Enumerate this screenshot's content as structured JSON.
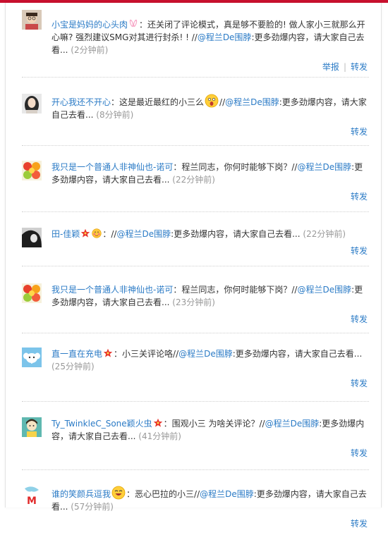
{
  "posts": [
    {
      "user": "小宝是妈妈的心头肉",
      "sep": "：",
      "text": "还关闭了评论模式，真是够不要脸的! 做人家小三就那么开心嘛? 强烈建议SMG对其进行封杀! ! ",
      "repost_prefix": "//",
      "mention": "@程兰De围脖",
      "mention_text": ":更多劲爆内容，请大家自己去看...",
      "time": "(2分钟前)",
      "report": "举报",
      "action_sep": "|",
      "forward": "转发"
    },
    {
      "user": "开心我还不开心",
      "sep": "：",
      "text": "这是最近最红的小三么",
      "repost_prefix": "//",
      "mention": "@程兰De围脖",
      "mention_text": ":更多劲爆内容，请大家自己去看...",
      "time": "(8分钟前)",
      "forward": "转发"
    },
    {
      "user": "我只是一个普通人非神仙也-诺可",
      "sep": "：",
      "text": "程兰同志，你何时能够下岗？",
      "repost_prefix": "//",
      "mention": "@程兰De围脖",
      "mention_text": ":更多劲爆内容，请大家自己去看...",
      "time": "(22分钟前)",
      "forward": "转发"
    },
    {
      "user": "田-佳颖",
      "sep": "：",
      "text": "",
      "repost_prefix": "//",
      "mention": "@程兰De围脖",
      "mention_text": ":更多劲爆内容，请大家自己去看...",
      "time": "(22分钟前)",
      "forward": "转发"
    },
    {
      "user": "我只是一个普通人非神仙也-诺可",
      "sep": "：",
      "text": "程兰同志，你何时能够下岗？",
      "repost_prefix": "//",
      "mention": "@程兰De围脖",
      "mention_text": ":更多劲爆内容，请大家自己去看...",
      "time": "(23分钟前)",
      "forward": "转发"
    },
    {
      "user": "直一直在充电",
      "sep": "：",
      "text": "小三关评论咯",
      "repost_prefix": "//",
      "mention": "@程兰De围脖",
      "mention_text": ":更多劲爆内容，请大家自己去看...",
      "time": "(25分钟前)",
      "forward": "转发"
    },
    {
      "user": "Ty_TwinkleC_Sone颖火虫",
      "sep": "：",
      "text": "围观小三 为啥关评论？",
      "repost_prefix": "//",
      "mention": "@程兰De围脖",
      "mention_text": ":更多劲爆内容，请大家自己去看...",
      "time": "(41分钟前)",
      "forward": "转发"
    },
    {
      "user": "谁的笑颜兵逗我",
      "sep": "：",
      "text": "恶心巴拉的小三",
      "repost_prefix": "//",
      "mention": "@程兰De围脖",
      "mention_text": ":更多劲爆内容，请大家自己去看...",
      "time": "(57分钟前)",
      "forward": "转发"
    }
  ],
  "colors": {
    "link": "#2b7bc6",
    "time": "#999999",
    "top_bar": "#c8102e"
  },
  "icons": {
    "badge_rabbit": "rabbit-ears-icon",
    "badge_star": "red-star-icon",
    "emoji_shocked": "shocked-face-emoji-icon",
    "emoji_blush": "blush-face-emoji-icon",
    "emoji_laugh": "laugh-face-emoji-icon"
  }
}
